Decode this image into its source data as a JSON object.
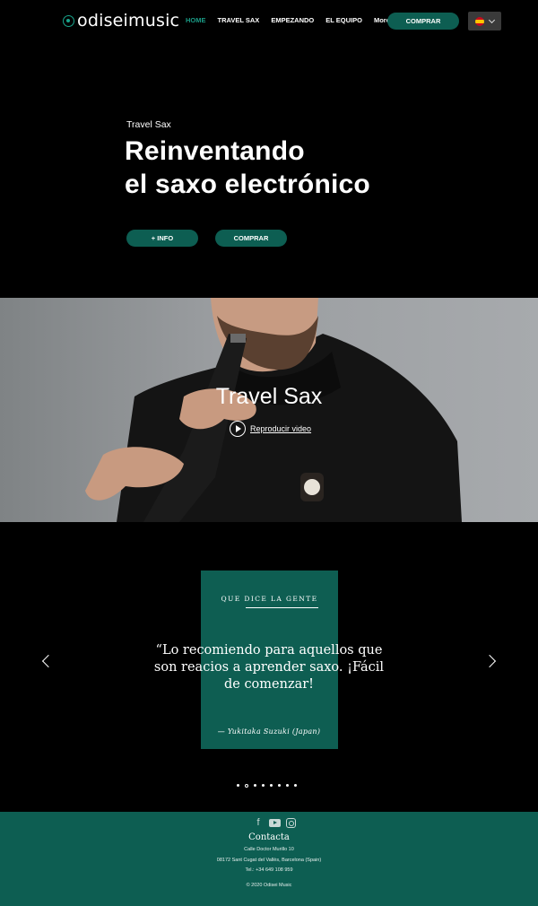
{
  "header": {
    "logo_text": "odiseimusic",
    "nav": [
      {
        "label": "HOME",
        "active": true
      },
      {
        "label": "TRAVEL SAX",
        "active": false
      },
      {
        "label": "EMPEZANDO",
        "active": false
      },
      {
        "label": "EL EQUIPO",
        "active": false
      },
      {
        "label": "More",
        "active": false
      }
    ],
    "buy_label": "COMPRAR",
    "language": "es",
    "accent_color": "#1a9a85",
    "button_color": "#0d5e52"
  },
  "hero": {
    "kicker": "Travel Sax",
    "title_line1": "Reinventando",
    "title_line2": "el saxo electrónico",
    "info_button": "+ INFO",
    "buy_button": "COMPRAR"
  },
  "video": {
    "title": "Travel Sax",
    "play_label": "Reproducir video"
  },
  "testimonials": {
    "kicker": "QUE DICE LA GENTE",
    "quote": "“Lo recomiendo para aquellos que son reacios a aprender saxo. ¡Fácil de comenzar!",
    "author": "—  Yukitaka Suzuki (Japan)",
    "slide_count": 8,
    "active_slide": 1,
    "card_color": "#0e5e52"
  },
  "footer": {
    "social": [
      "facebook-icon",
      "youtube-icon",
      "instagram-icon"
    ],
    "contact_title": "Contacta",
    "address1": "Calle Doctor Murillo 10",
    "address2": "08172 Sant Cugat del Vallès, Barcelona (Spain)",
    "phone": "Tel.: +34 649 108 959",
    "copyright": "© 2020 Odisei Music",
    "background_color": "#0d5e52"
  }
}
